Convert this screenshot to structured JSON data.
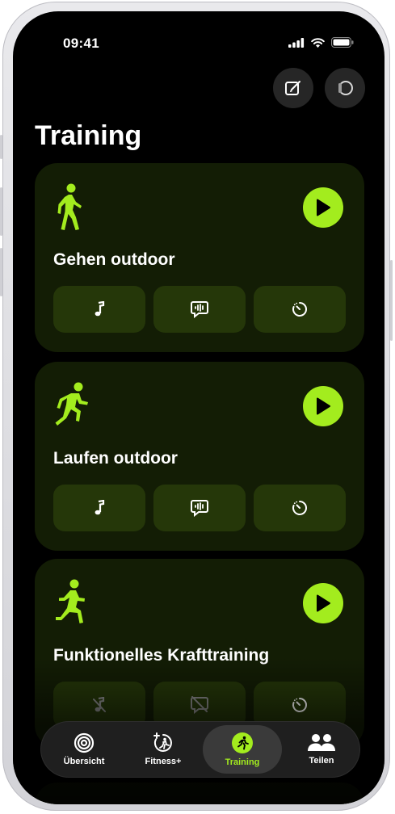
{
  "status_bar": {
    "time": "09:41"
  },
  "header": {
    "title": "Training",
    "edit_icon": "compose-icon",
    "watch_icon": "watch-icon"
  },
  "workouts": [
    {
      "title": "Gehen outdoor",
      "icon": "walking-figure-icon",
      "options": [
        "music-note-icon",
        "voice-feedback-icon",
        "timer-icon"
      ],
      "options_disabled": [
        false,
        false,
        false
      ]
    },
    {
      "title": "Laufen outdoor",
      "icon": "running-figure-icon",
      "options": [
        "music-note-icon",
        "voice-feedback-icon",
        "timer-icon"
      ],
      "options_disabled": [
        false,
        false,
        false
      ]
    },
    {
      "title": "Funktionelles Krafttraining",
      "icon": "strength-figure-icon",
      "options": [
        "music-slash-icon",
        "voice-feedback-slash-icon",
        "timer-icon"
      ],
      "options_disabled": [
        true,
        true,
        false
      ]
    }
  ],
  "tab_bar": {
    "tabs": [
      {
        "label": "Übersicht",
        "icon": "rings-icon",
        "active": false
      },
      {
        "label": "Fitness+",
        "icon": "fitness-plus-icon",
        "active": false
      },
      {
        "label": "Training",
        "icon": "running-icon",
        "active": true
      },
      {
        "label": "Teilen",
        "icon": "people-icon",
        "active": false
      }
    ]
  },
  "colors": {
    "accent": "#a3ec1e",
    "card_bg": "#131d05",
    "option_bg": "#253709",
    "background": "#000000"
  }
}
